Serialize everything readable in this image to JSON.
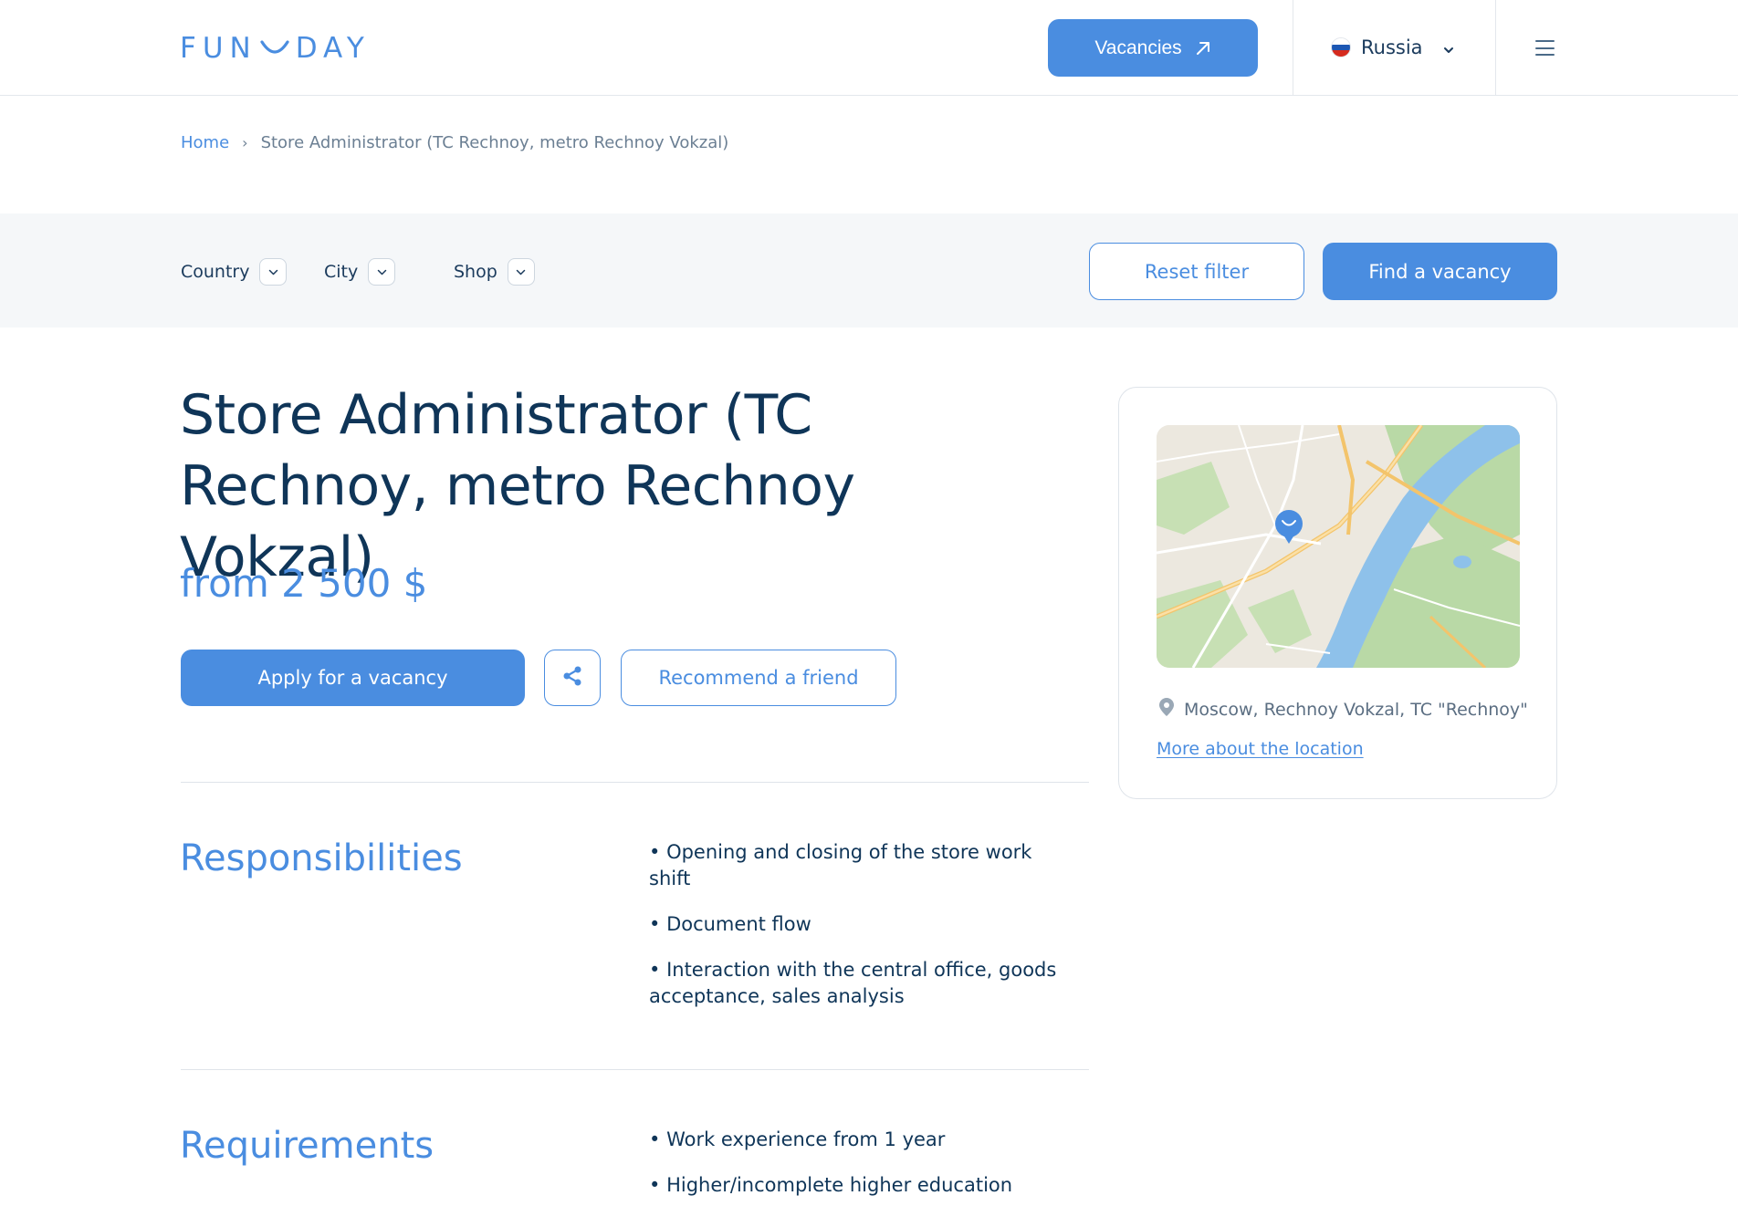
{
  "header": {
    "logo_text_left": "FUN",
    "logo_text_right": "DAY",
    "vacancies_label": "Vacancies",
    "country_label": "Russia",
    "flag_colors": [
      "#ffffff",
      "#1c57b3",
      "#d52b1e"
    ]
  },
  "breadcrumb": {
    "home": "Home",
    "separator": "›",
    "current": "Store Administrator (TC Rechnoy, metro Rechnoy Vokzal)"
  },
  "filters": {
    "country": "Country",
    "city": "City",
    "shop": "Shop",
    "reset_label": "Reset filter",
    "find_label": "Find a vacancy"
  },
  "vacancy": {
    "title": "Store Administrator (TC Rechnoy, metro Rechnoy Vokzal)",
    "salary": "from 2 500 $",
    "apply_label": "Apply for a vacancy",
    "recommend_label": "Recommend a friend"
  },
  "location": {
    "address": "Moscow, Rechnoy Vokzal, TC \"Rechnoy\"",
    "more_link": "More about the location"
  },
  "sections": {
    "responsibilities": {
      "title": "Responsibilities",
      "items": [
        "Opening and closing of the store work shift",
        "Document flow",
        "Interaction with the central office, goods acceptance, sales analysis"
      ]
    },
    "requirements": {
      "title": "Requirements",
      "items": [
        "Work experience from 1 year",
        "Higher/incomplete higher education"
      ]
    }
  },
  "colors": {
    "accent": "#4a8de0",
    "heading": "#0f3558",
    "muted": "#6b7f93",
    "filter_bg": "#f5f7f9"
  }
}
